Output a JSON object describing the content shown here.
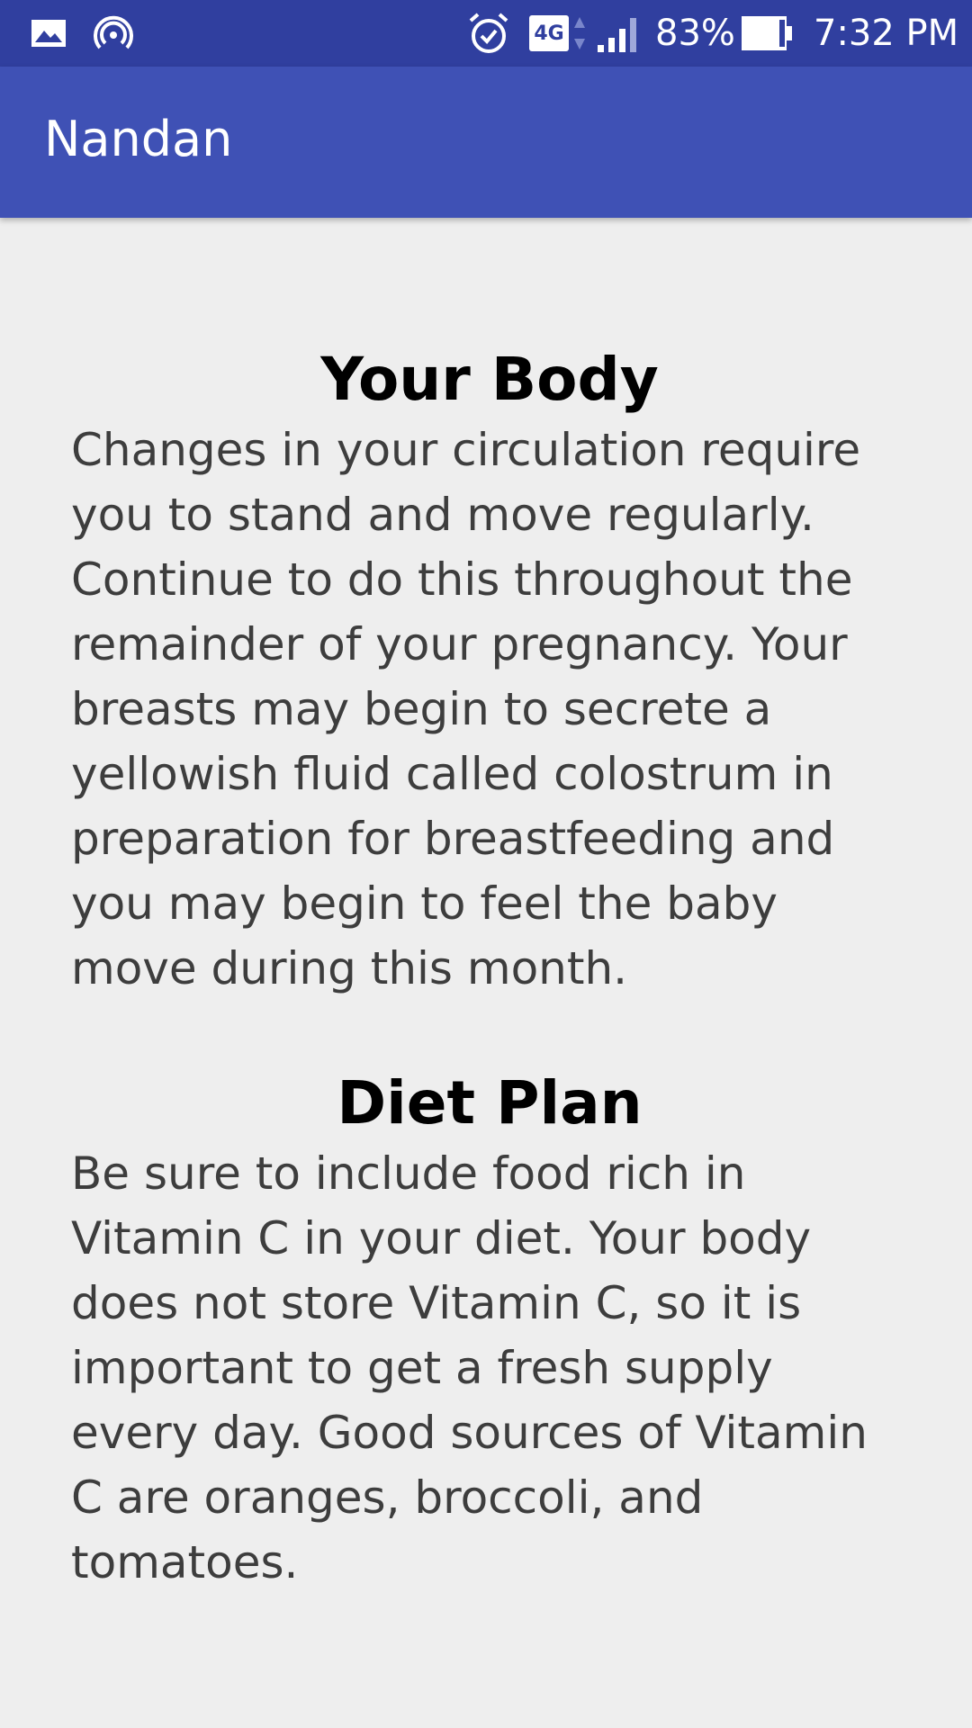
{
  "status_bar": {
    "icons": [
      "image-icon",
      "hotspot-icon",
      "alarm-icon",
      "network-4g-icon",
      "signal-icon",
      "battery-icon"
    ],
    "network_label": "4G",
    "battery": "83%",
    "time": "7:32 PM"
  },
  "app_bar": {
    "title": "Nandan"
  },
  "sections": [
    {
      "heading": "Your Body",
      "body": "Changes in your circulation require you to stand and move regularly. Continue to do this throughout the remainder of your pregnancy. Your breasts may begin to secrete a yellowish fluid called colostrum in preparation for breastfeeding and you may begin to feel the baby move during this month."
    },
    {
      "heading": "Diet Plan",
      "body": "Be sure to include food rich in Vitamin C in your diet. Your body does not store Vitamin C, so it is important to get a fresh supply every day. Good sources of Vitamin C are oranges, broccoli, and tomatoes."
    }
  ],
  "colors": {
    "status_bar": "#303f9f",
    "app_bar": "#3f51b5",
    "background": "#eeeeee",
    "heading": "#000000",
    "body_text": "#3d3d3d"
  }
}
